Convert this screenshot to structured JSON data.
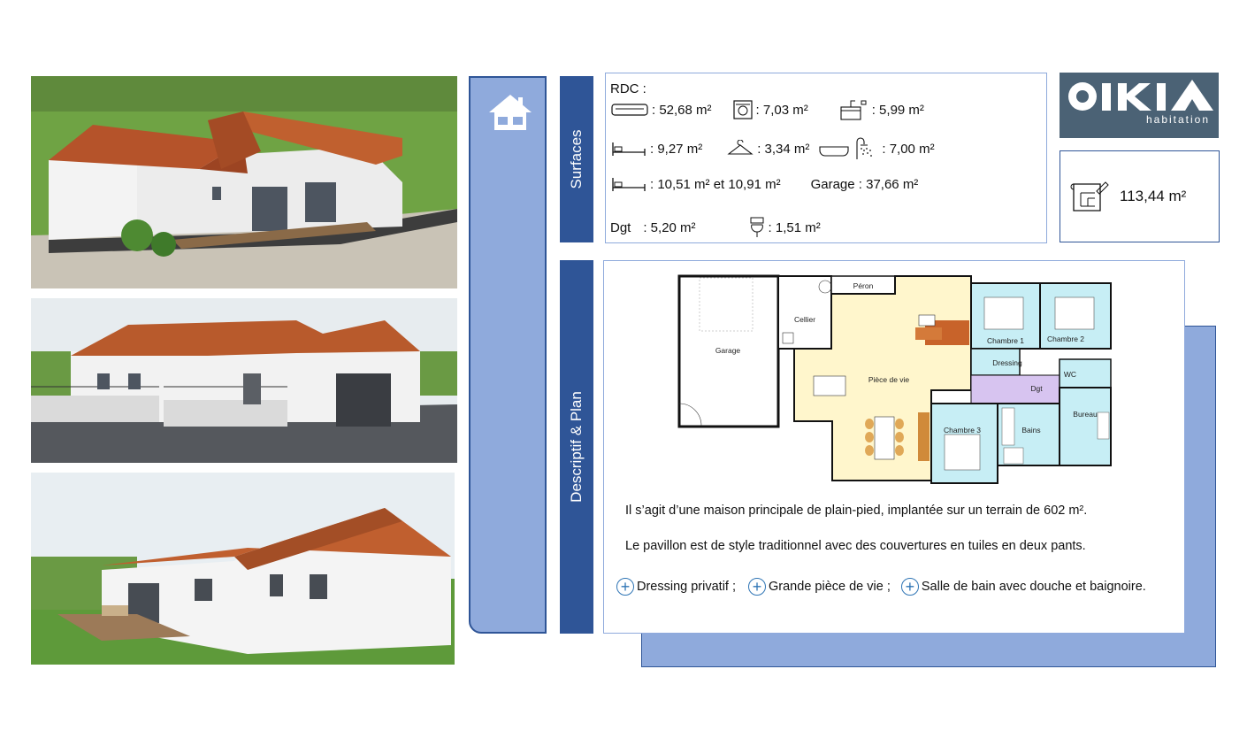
{
  "icons": {
    "house": "house-icon",
    "sofa": "sofa-icon",
    "washer": "washing-machine-icon",
    "kitchen": "kitchen-sink-icon",
    "bed": "bed-icon",
    "hanger": "hanger-icon",
    "bathtub": "bathtub-icon",
    "shower": "shower-icon",
    "toilet": "toilet-icon",
    "blueprint": "floor-plan-icon",
    "plus": "plus-circle-icon"
  },
  "colors": {
    "panel_fill": "#8faadc",
    "panel_dark": "#2f5597",
    "logo_bg": "#4b6275"
  },
  "surfaces": {
    "tab_label": "Surfaces",
    "level": "RDC :",
    "living": ": 52,68 m²",
    "laundry": ": 7,03 m²",
    "kitchen": ": 5,99 m²",
    "bedroom1": ": 9,27 m²",
    "dressing": ": 3,34 m²",
    "bathroom": ": 7,00 m²",
    "bedrooms_23": ": 10,51 m² et 10,91 m²",
    "garage": "Garage  : 37,66 m²",
    "dgt_label": "Dgt",
    "dgt_value": ": 5,20 m²",
    "wc": ": 1,51 m²"
  },
  "logo": {
    "brand": "OIKIA",
    "sub": "habitation"
  },
  "total": {
    "value": "113,44 m²"
  },
  "plan": {
    "tab_label": "Descriptif & Plan",
    "rooms": {
      "garage": "Garage",
      "cellier": "Cellier",
      "peron": "Péron",
      "piece_de_vie": "Pièce de vie",
      "chambre1": "Chambre 1",
      "chambre2": "Chambre 2",
      "chambre3": "Chambre 3",
      "dressing": "Dressing",
      "dgt": "Dgt",
      "wc": "WC",
      "bureau": "Bureau",
      "bains": "Bains"
    }
  },
  "description": {
    "line1": "Il s’agit d’une maison principale de plain-pied, implantée sur un terrain de  602 m².",
    "line2": "Le pavillon est de style traditionnel avec des couvertures en tuiles en deux pants.",
    "features": [
      "Dressing privatif ;",
      "Grande pièce de vie ;",
      "Salle de bain avec douche et baignoire."
    ]
  }
}
